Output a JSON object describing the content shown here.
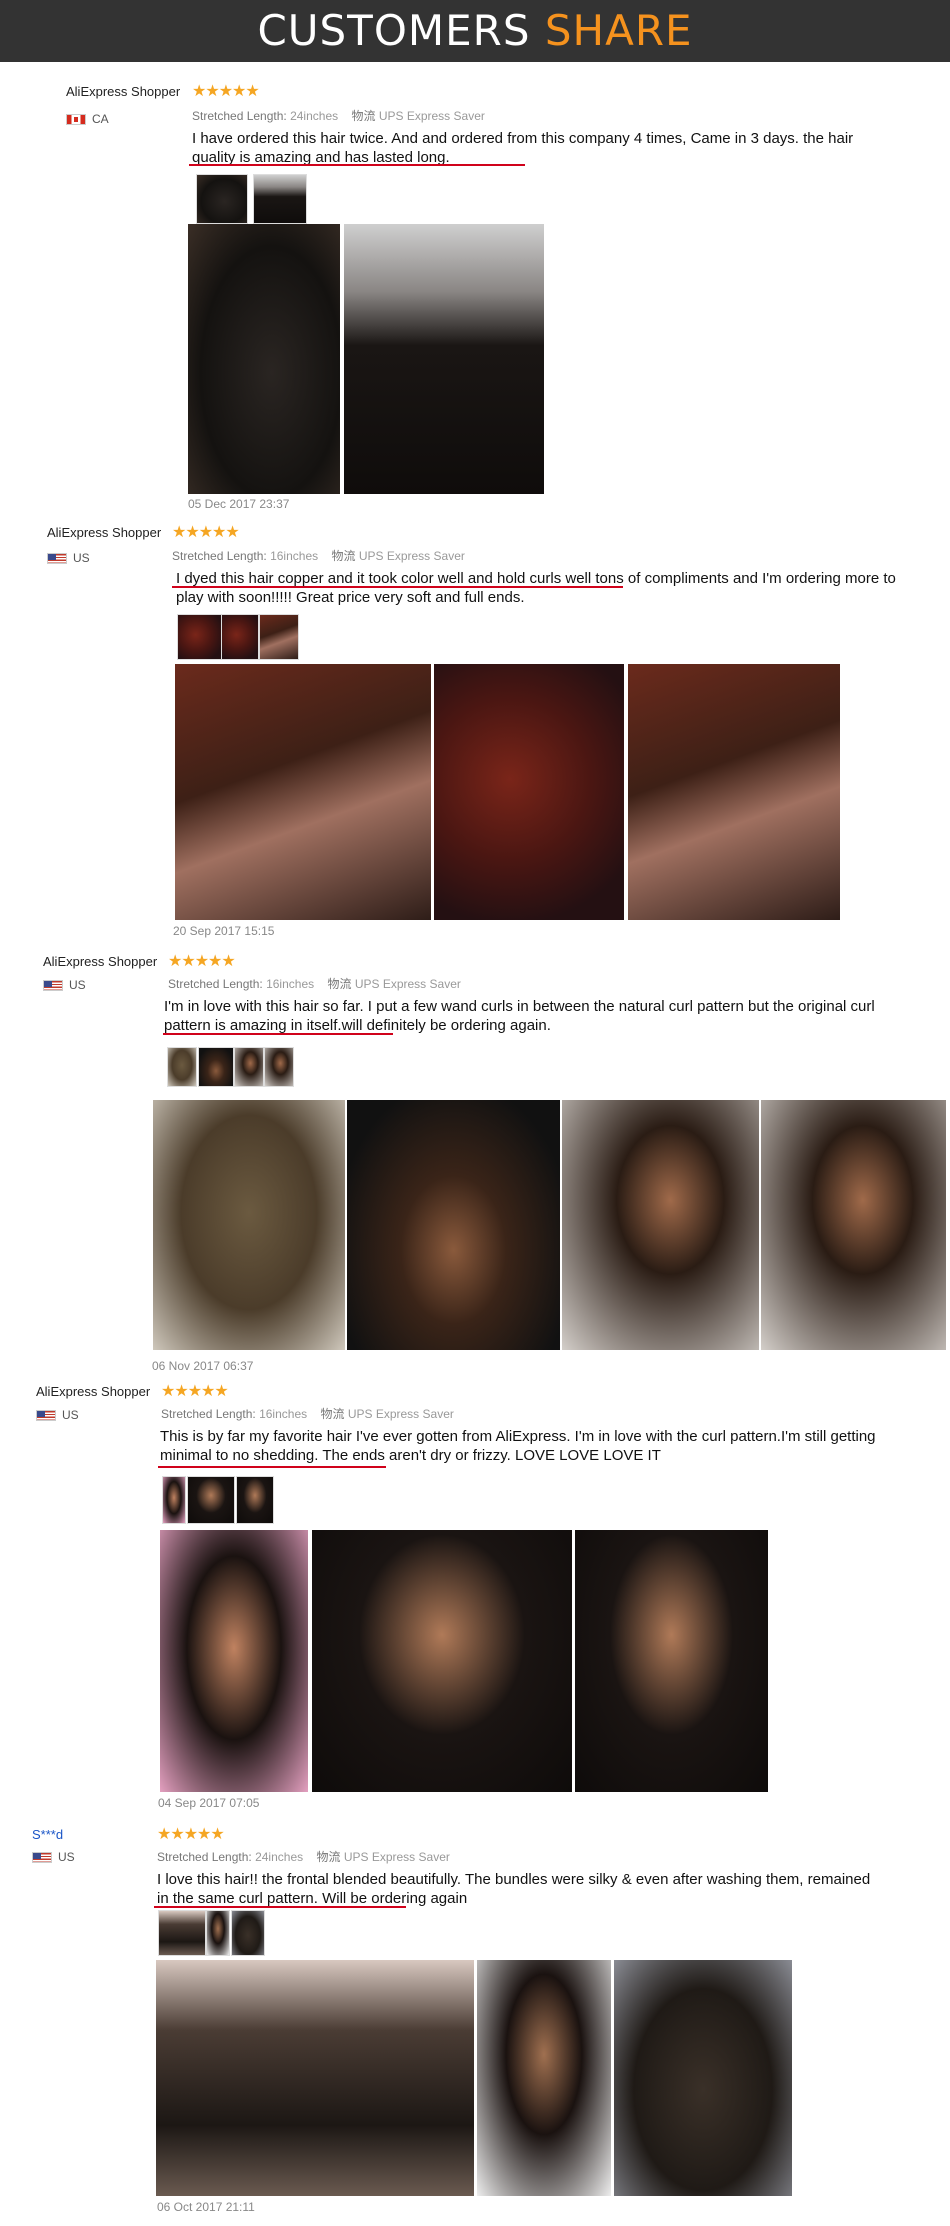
{
  "header": {
    "title_part1": "CUSTOMERS",
    "title_part2": "SHARE",
    "accent_color": "#f5921e"
  },
  "stars": "★★★★★",
  "shipping_prefix": "物流",
  "reviews": [
    {
      "name": "AliExpress Shopper",
      "country": "CA",
      "stretched_label": "Stretched Length:",
      "stretched_value": "24inches",
      "shipping": "UPS Express Saver",
      "text": "I have ordered this hair twice. And and ordered from this company 4 times, Came in 3 days. the hair quality is amazing and has lasted long.",
      "date": "05 Dec 2017 23:37"
    },
    {
      "name": "AliExpress Shopper",
      "country": "US",
      "stretched_label": "Stretched Length:",
      "stretched_value": "16inches",
      "shipping": "UPS Express Saver",
      "text": "I dyed this hair copper and it took color well and hold curls well tons of compliments and I'm ordering more to play with soon!!!!! Great price very soft and full ends.",
      "date": "20 Sep 2017 15:15"
    },
    {
      "name": "AliExpress Shopper",
      "country": "US",
      "stretched_label": "Stretched Length:",
      "stretched_value": "16inches",
      "shipping": "UPS Express Saver",
      "text": "I'm in love with this hair so far. I put a few wand curls in between the natural curl pattern but the original curl pattern is amazing in itself.will definitely be ordering again.",
      "date": "06 Nov 2017 06:37"
    },
    {
      "name": "AliExpress Shopper",
      "country": "US",
      "stretched_label": "Stretched Length:",
      "stretched_value": "16inches",
      "shipping": "UPS Express Saver",
      "text": "This is by far my favorite hair I've ever gotten from AliExpress. I'm in love with the curl pattern.I'm still getting minimal to no shedding. The ends aren't dry or frizzy. LOVE LOVE LOVE IT",
      "date": "04 Sep 2017 07:05"
    },
    {
      "name": "S***d",
      "country": "US",
      "stretched_label": "Stretched Length:",
      "stretched_value": "24inches",
      "shipping": "UPS Express Saver",
      "text": "I love this hair!! the frontal blended beautifully. The bundles were silky & even after washing them, remained in the same curl pattern. Will be ordering again",
      "date": "06 Oct 2017 21:11"
    }
  ]
}
